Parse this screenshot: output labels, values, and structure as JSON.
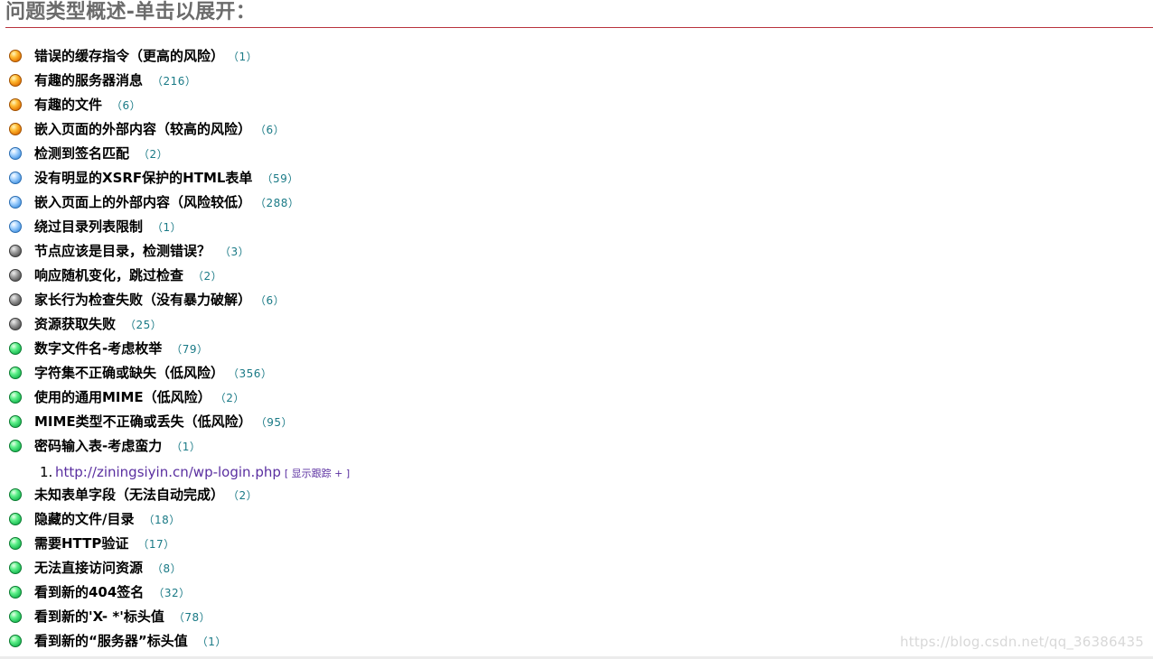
{
  "header": {
    "title": "问题类型概述-单击以展开："
  },
  "items": [
    {
      "label": "错误的缓存指令（更高的风险）",
      "count": "（1）",
      "severity": "orange"
    },
    {
      "label": "有趣的服务器消息",
      "count": "（216）",
      "severity": "orange"
    },
    {
      "label": "有趣的文件",
      "count": "（6）",
      "severity": "orange"
    },
    {
      "label": "嵌入页面的外部内容（较高的风险）",
      "count": "（6）",
      "severity": "orange"
    },
    {
      "label": "检测到签名匹配",
      "count": "（2）",
      "severity": "blue"
    },
    {
      "label": "没有明显的XSRF保护的HTML表单",
      "count": "（59）",
      "severity": "blue"
    },
    {
      "label": "嵌入页面上的外部内容（风险较低）",
      "count": "（288）",
      "severity": "blue"
    },
    {
      "label": "绕过目录列表限制",
      "count": "（1）",
      "severity": "blue"
    },
    {
      "label": "节点应该是目录，检测错误？",
      "count": "（3）",
      "severity": "gray"
    },
    {
      "label": "响应随机变化，跳过检查",
      "count": "（2）",
      "severity": "gray"
    },
    {
      "label": "家长行为检查失败（没有暴力破解）",
      "count": "（6）",
      "severity": "gray"
    },
    {
      "label": "资源获取失败",
      "count": "（25）",
      "severity": "gray"
    },
    {
      "label": "数字文件名-考虑枚举",
      "count": "（79）",
      "severity": "green"
    },
    {
      "label": "字符集不正确或缺失（低风险）",
      "count": "（356）",
      "severity": "green"
    },
    {
      "label": "使用的通用MIME（低风险）",
      "count": "（2）",
      "severity": "green"
    },
    {
      "label": "MIME类型不正确或丢失（低风险）",
      "count": "（95）",
      "severity": "green"
    },
    {
      "label": "密码输入表-考虑蛮力",
      "count": "（1）",
      "severity": "green"
    },
    {
      "label": "未知表单字段（无法自动完成）",
      "count": "（2）",
      "severity": "green"
    },
    {
      "label": "隐藏的文件/目录",
      "count": "（18）",
      "severity": "green"
    },
    {
      "label": "需要HTTP验证",
      "count": "（17）",
      "severity": "green"
    },
    {
      "label": "无法直接访问资源",
      "count": "（8）",
      "severity": "green"
    },
    {
      "label": "看到新的404签名",
      "count": "（32）",
      "severity": "green"
    },
    {
      "label": "看到新的'X- *'标头值",
      "count": "（78）",
      "severity": "green"
    },
    {
      "label": "看到新的“服务器”标头值",
      "count": "（1）",
      "severity": "green"
    }
  ],
  "expanded": {
    "number": "1.",
    "url": "http://ziningsiyin.cn/wp-login.php",
    "trace": "[ 显示跟踪 + ]"
  },
  "watermark": "https://blog.csdn.net/qq_36386435"
}
